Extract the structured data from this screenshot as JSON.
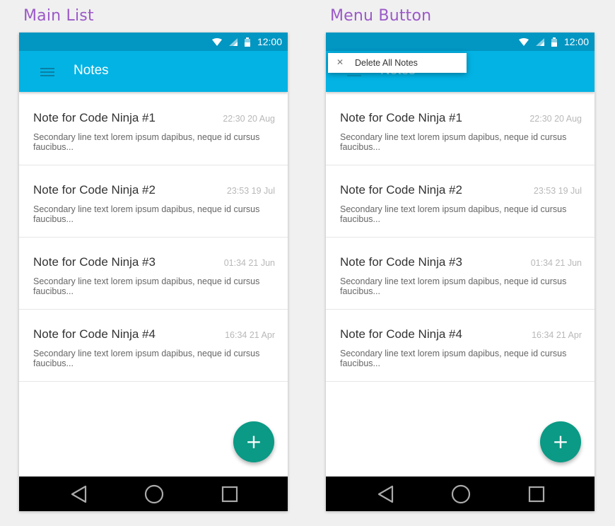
{
  "panels": [
    {
      "title": "Main List"
    },
    {
      "title": "Menu Button"
    }
  ],
  "status_bar": {
    "time": "12:00",
    "icons": [
      "wifi-icon",
      "signal-icon",
      "battery-icon"
    ]
  },
  "app_bar": {
    "title": "Notes",
    "menu_icon": "hamburger-icon"
  },
  "notes": [
    {
      "title": "Note for Code Ninja #1",
      "date": "22:30 20 Aug",
      "body": "Secondary line text lorem ipsum dapibus, neque id cursus faucibus..."
    },
    {
      "title": "Note for Code Ninja #2",
      "date": "23:53 19 Jul",
      "body": "Secondary line text lorem ipsum dapibus, neque id cursus faucibus..."
    },
    {
      "title": "Note for Code Ninja #3",
      "date": "01:34 21 Jun",
      "body": "Secondary line text lorem ipsum dapibus, neque id cursus faucibus..."
    },
    {
      "title": "Note for Code Ninja #4",
      "date": "16:34 21 Apr",
      "body": "Secondary line text lorem ipsum dapibus, neque id cursus faucibus..."
    }
  ],
  "fab": {
    "label": "+",
    "icon": "add-icon"
  },
  "menu": {
    "close_glyph": "✕",
    "item": "Delete All Notes"
  },
  "colors": {
    "status_bar": "#0296c2",
    "app_bar": "#03b3e4",
    "fab": "#0a9a85",
    "title_accent": "#9b59c7"
  }
}
